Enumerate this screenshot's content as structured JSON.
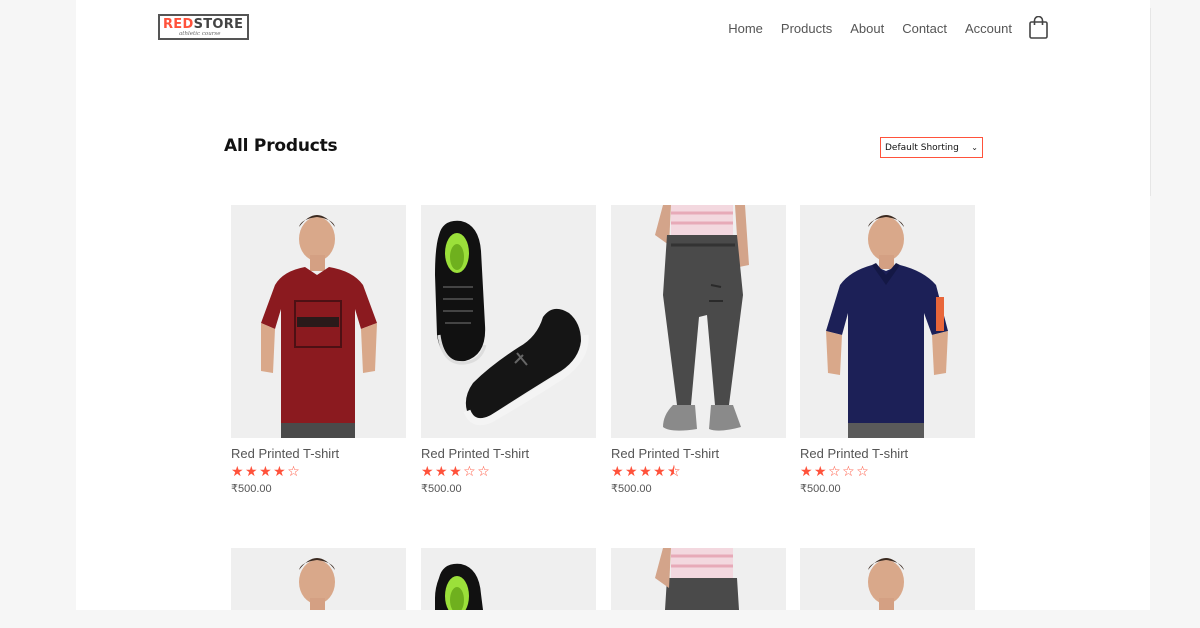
{
  "brand": {
    "primary": "RED",
    "secondary": "STORE",
    "tagline": "athletic course"
  },
  "nav": {
    "items": [
      "Home",
      "Products",
      "About",
      "Contact",
      "Account"
    ]
  },
  "icons": {
    "cart": "shopping-bag-icon"
  },
  "main": {
    "title": "All Products",
    "sort": {
      "selected": "Default Shorting"
    }
  },
  "products": [
    {
      "name": "Red Printed T-shirt",
      "rating_text": "★★★★☆",
      "rating": 4,
      "price": "₹500.00",
      "image": "man in maroon printed t-shirt"
    },
    {
      "name": "Red Printed T-shirt",
      "rating_text": "★★★☆☆",
      "rating": 3,
      "price": "₹500.00",
      "image": "pair of black running shoes"
    },
    {
      "name": "Red Printed T-shirt",
      "rating_text": "★★★★⯪",
      "rating": 4.5,
      "price": "₹500.00",
      "image": "grey jogger pants"
    },
    {
      "name": "Red Printed T-shirt",
      "rating_text": "★★☆☆☆",
      "rating": 2,
      "price": "₹500.00",
      "image": "man in navy polo shirt"
    }
  ],
  "colors": {
    "accent": "#ff523b",
    "text": "#555555",
    "heading": "#111111",
    "card_bg": "#efefef"
  }
}
